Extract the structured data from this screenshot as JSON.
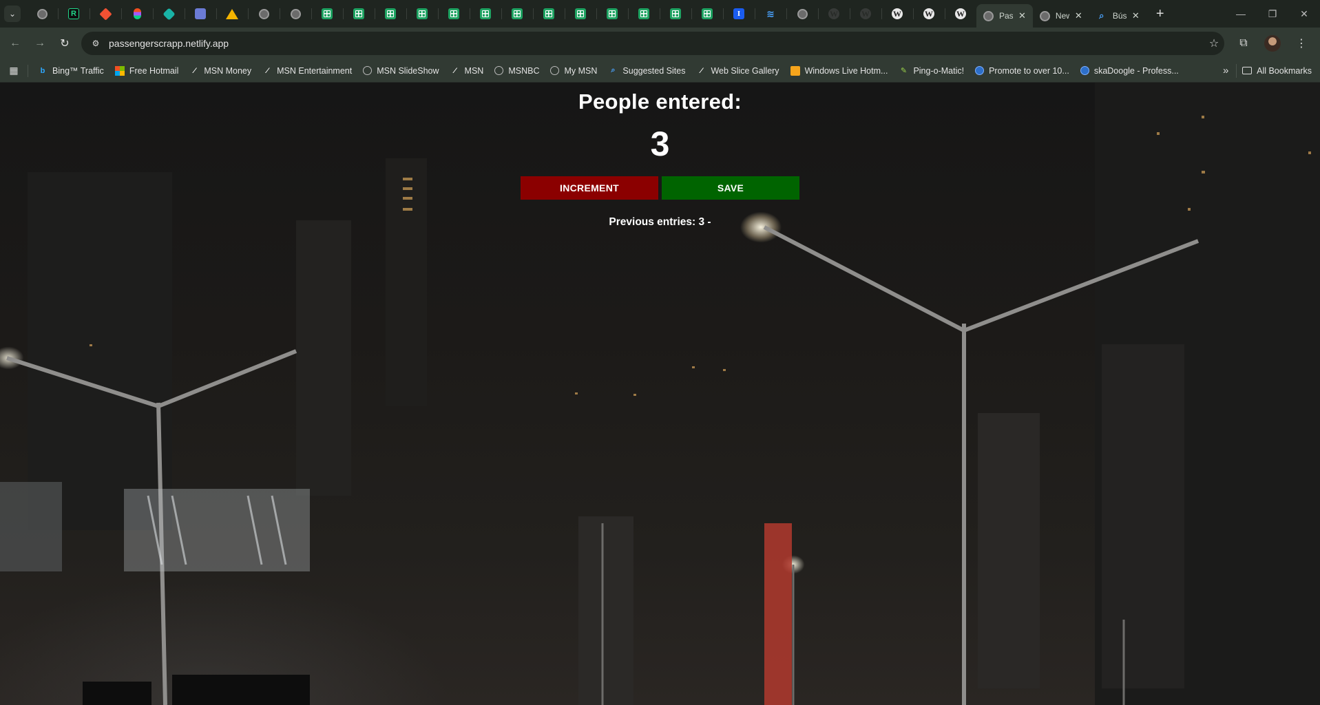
{
  "browser": {
    "pinned_icons": [
      "globe-icon",
      "pycharm-icon",
      "git-icon",
      "figma-icon",
      "diamond-icon",
      "photo-icon",
      "drive-icon",
      "globe-icon",
      "globe-icon",
      "sheets-icon",
      "sheets-icon",
      "sheets-icon",
      "sheets-icon",
      "sheets-icon",
      "sheets-icon",
      "sheets-icon",
      "sheets-icon",
      "sheets-icon",
      "sheets-icon",
      "sheets-icon",
      "sheets-icon",
      "sheets-icon",
      "info-icon",
      "wave-icon",
      "globe-icon",
      "wordpress-icon",
      "wordpress-icon",
      "wordpress-icon",
      "wordpress-icon",
      "wordpress-icon"
    ],
    "tabs": [
      {
        "title": "Pass",
        "active": true,
        "icon": "globe-icon"
      },
      {
        "title": "New",
        "active": false,
        "icon": "chrome-icon"
      },
      {
        "title": "Bús",
        "active": false,
        "icon": "search-icon"
      }
    ],
    "url": "passengerscrapp.netlify.app",
    "bookmarks": [
      {
        "label": "Bing™ Traffic",
        "icon": "bing-icon"
      },
      {
        "label": "Free Hotmail",
        "icon": "microsoft-icon"
      },
      {
        "label": "MSN Money",
        "icon": "msn-icon"
      },
      {
        "label": "MSN Entertainment",
        "icon": "msn-icon"
      },
      {
        "label": "MSN SlideShow",
        "icon": "globe-icon"
      },
      {
        "label": "MSN",
        "icon": "msn-icon"
      },
      {
        "label": "MSNBC",
        "icon": "globe-icon"
      },
      {
        "label": "My MSN",
        "icon": "globe-icon"
      },
      {
        "label": "Suggested Sites",
        "icon": "search-icon"
      },
      {
        "label": "Web Slice Gallery",
        "icon": "msn-icon"
      },
      {
        "label": "Windows Live Hotm...",
        "icon": "mail-icon"
      },
      {
        "label": "Ping-o-Matic!",
        "icon": "feather-icon"
      },
      {
        "label": "Promote to over 10...",
        "icon": "globe-icon"
      },
      {
        "label": "skaDoogle - Profess...",
        "icon": "globe-icon"
      }
    ],
    "all_bookmarks": "All Bookmarks"
  },
  "app": {
    "heading": "People entered:",
    "count": "3",
    "increment_label": "INCREMENT",
    "save_label": "SAVE",
    "previous_entries": "Previous entries: 3 -"
  },
  "colors": {
    "increment_button": "#8b0000",
    "save_button": "#006400",
    "text": "#ffffff"
  }
}
